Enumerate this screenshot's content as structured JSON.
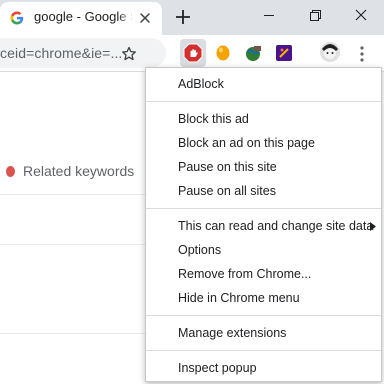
{
  "tab": {
    "title": "google - Google Search"
  },
  "toolbar": {
    "url": "ceid=chrome&ie=..."
  },
  "page": {
    "related_keywords": "Related keywords"
  },
  "extensions": [
    "adblock-icon",
    "orange-circle-icon",
    "globe-icon",
    "purple-square-icon",
    "avatar"
  ],
  "menu": {
    "header": "AdBlock",
    "items": [
      "Block this ad",
      "Block an ad on this page",
      "Pause on this site",
      "Pause on all sites",
      "This can read and change site data",
      "Options",
      "Remove from Chrome...",
      "Hide in Chrome menu",
      "Manage extensions",
      "Inspect popup"
    ]
  },
  "colors": {
    "tabstrip": "#dee1e6",
    "omnibox": "#f1f3f4",
    "adblock_red": "#d32f2f",
    "related_dot": "#d9534f"
  }
}
